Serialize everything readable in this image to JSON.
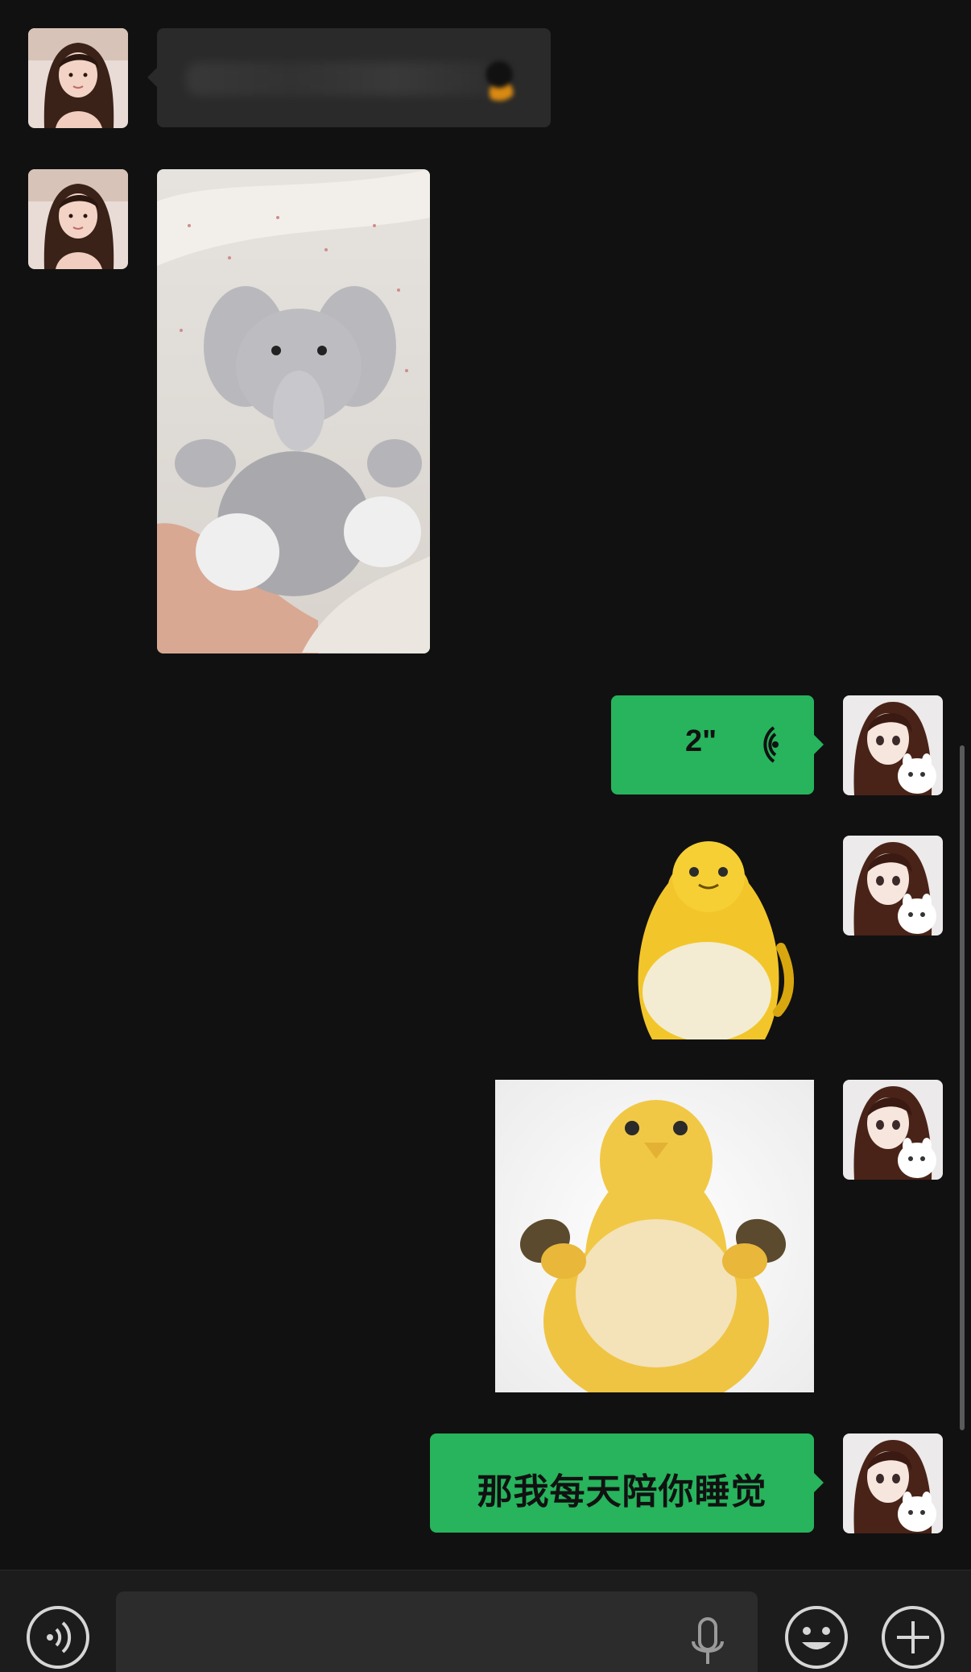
{
  "app": "WeChat",
  "messages": [
    {
      "side": "left",
      "type": "text-blurred",
      "avatar": "girl-photo-avatar"
    },
    {
      "side": "left",
      "type": "image",
      "description_icon": "elephant-plush-photo"
    },
    {
      "side": "right",
      "type": "voice",
      "duration": "2\"",
      "avatar": "anime-girl-avatar"
    },
    {
      "side": "right",
      "type": "sticker",
      "icon": "yellow-duck-sticker"
    },
    {
      "side": "right",
      "type": "sticker",
      "icon": "yellow-duck-waving-sticker"
    },
    {
      "side": "right",
      "type": "text",
      "text": "那我每天陪你睡觉"
    }
  ],
  "input_bar": {
    "icons": [
      "voice-mode-icon",
      "microphone-icon",
      "emoji-icon",
      "plus-icon"
    ]
  },
  "colors": {
    "background": "#111111",
    "incoming_bubble": "#2a2a2a",
    "outgoing_bubble": "#27b45c",
    "input_bar": "#1c1c1c"
  }
}
